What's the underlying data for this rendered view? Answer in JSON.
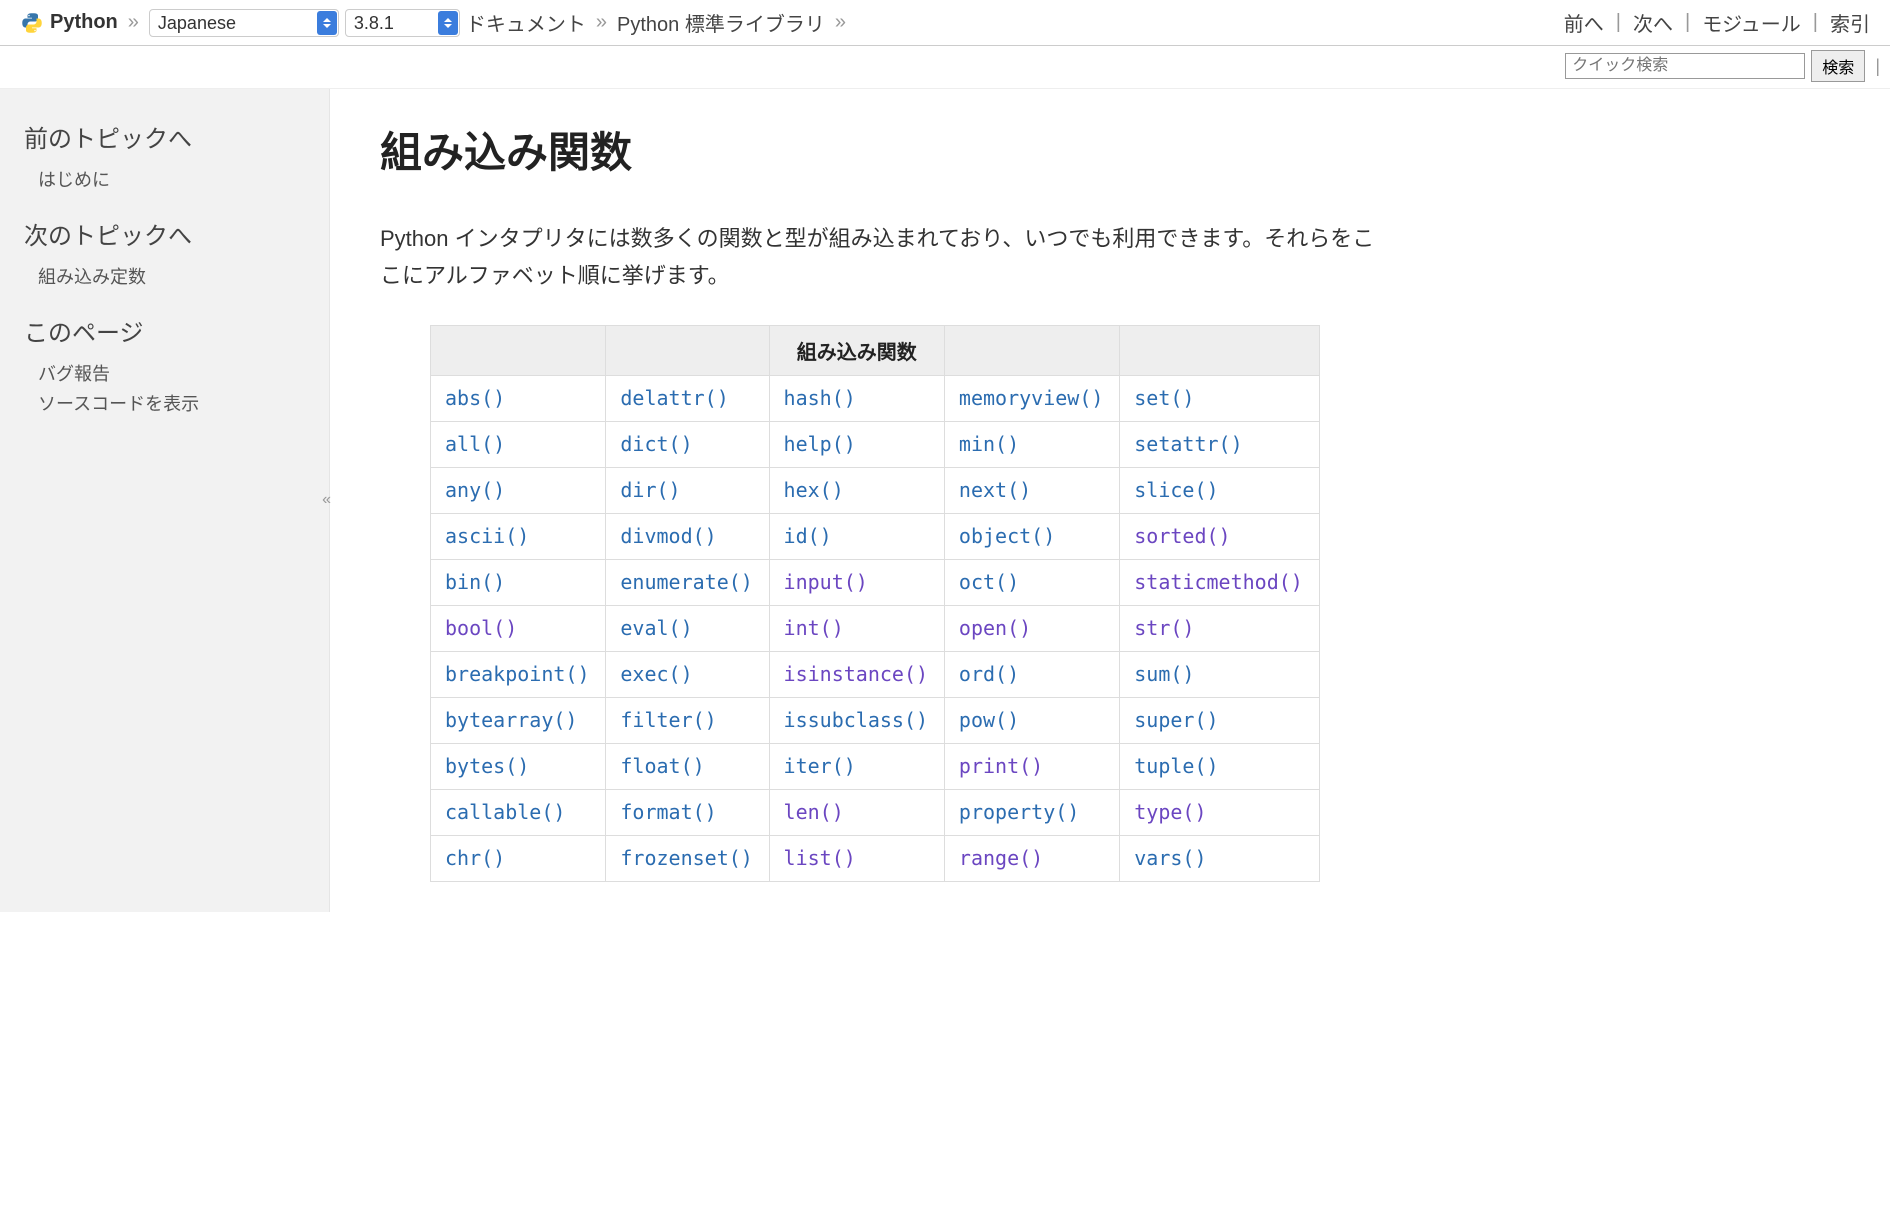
{
  "topbar": {
    "brand": "Python",
    "lang_selected": "Japanese",
    "version_selected": "3.8.1",
    "breadcrumbs": [
      "ドキュメント",
      "Python 標準ライブラリ"
    ],
    "nav": {
      "prev": "前へ",
      "next": "次へ",
      "modules": "モジュール",
      "index": "索引"
    }
  },
  "search": {
    "placeholder": "クイック検索",
    "button": "検索"
  },
  "sidebar": {
    "prev_heading": "前のトピックへ",
    "prev_link": "はじめに",
    "next_heading": "次のトピックへ",
    "next_link": "組み込み定数",
    "thispage_heading": "このページ",
    "bug_report": "バグ報告",
    "show_source": "ソースコードを表示"
  },
  "page": {
    "title": "組み込み関数",
    "intro": "Python インタプリタには数多くの関数と型が組み込まれており、いつでも利用できます。それらをここにアルファベット順に挙げます。",
    "table_header": "組み込み関数",
    "functions": [
      [
        {
          "t": "abs()",
          "v": 0
        },
        {
          "t": "delattr()",
          "v": 0
        },
        {
          "t": "hash()",
          "v": 0
        },
        {
          "t": "memoryview()",
          "v": 0
        },
        {
          "t": "set()",
          "v": 0
        }
      ],
      [
        {
          "t": "all()",
          "v": 0
        },
        {
          "t": "dict()",
          "v": 0
        },
        {
          "t": "help()",
          "v": 0
        },
        {
          "t": "min()",
          "v": 0
        },
        {
          "t": "setattr()",
          "v": 0
        }
      ],
      [
        {
          "t": "any()",
          "v": 0
        },
        {
          "t": "dir()",
          "v": 0
        },
        {
          "t": "hex()",
          "v": 0
        },
        {
          "t": "next()",
          "v": 0
        },
        {
          "t": "slice()",
          "v": 0
        }
      ],
      [
        {
          "t": "ascii()",
          "v": 0
        },
        {
          "t": "divmod()",
          "v": 0
        },
        {
          "t": "id()",
          "v": 0
        },
        {
          "t": "object()",
          "v": 0
        },
        {
          "t": "sorted()",
          "v": 1
        }
      ],
      [
        {
          "t": "bin()",
          "v": 0
        },
        {
          "t": "enumerate()",
          "v": 0
        },
        {
          "t": "input()",
          "v": 1
        },
        {
          "t": "oct()",
          "v": 0
        },
        {
          "t": "staticmethod()",
          "v": 1
        }
      ],
      [
        {
          "t": "bool()",
          "v": 1
        },
        {
          "t": "eval()",
          "v": 0
        },
        {
          "t": "int()",
          "v": 1
        },
        {
          "t": "open()",
          "v": 1
        },
        {
          "t": "str()",
          "v": 1
        }
      ],
      [
        {
          "t": "breakpoint()",
          "v": 0
        },
        {
          "t": "exec()",
          "v": 0
        },
        {
          "t": "isinstance()",
          "v": 1
        },
        {
          "t": "ord()",
          "v": 0
        },
        {
          "t": "sum()",
          "v": 0
        }
      ],
      [
        {
          "t": "bytearray()",
          "v": 0
        },
        {
          "t": "filter()",
          "v": 0
        },
        {
          "t": "issubclass()",
          "v": 0
        },
        {
          "t": "pow()",
          "v": 0
        },
        {
          "t": "super()",
          "v": 0
        }
      ],
      [
        {
          "t": "bytes()",
          "v": 0
        },
        {
          "t": "float()",
          "v": 0
        },
        {
          "t": "iter()",
          "v": 0
        },
        {
          "t": "print()",
          "v": 1
        },
        {
          "t": "tuple()",
          "v": 0
        }
      ],
      [
        {
          "t": "callable()",
          "v": 0
        },
        {
          "t": "format()",
          "v": 0
        },
        {
          "t": "len()",
          "v": 1
        },
        {
          "t": "property()",
          "v": 0
        },
        {
          "t": "type()",
          "v": 1
        }
      ],
      [
        {
          "t": "chr()",
          "v": 0
        },
        {
          "t": "frozenset()",
          "v": 0
        },
        {
          "t": "list()",
          "v": 1
        },
        {
          "t": "range()",
          "v": 1
        },
        {
          "t": "vars()",
          "v": 0
        }
      ]
    ]
  }
}
